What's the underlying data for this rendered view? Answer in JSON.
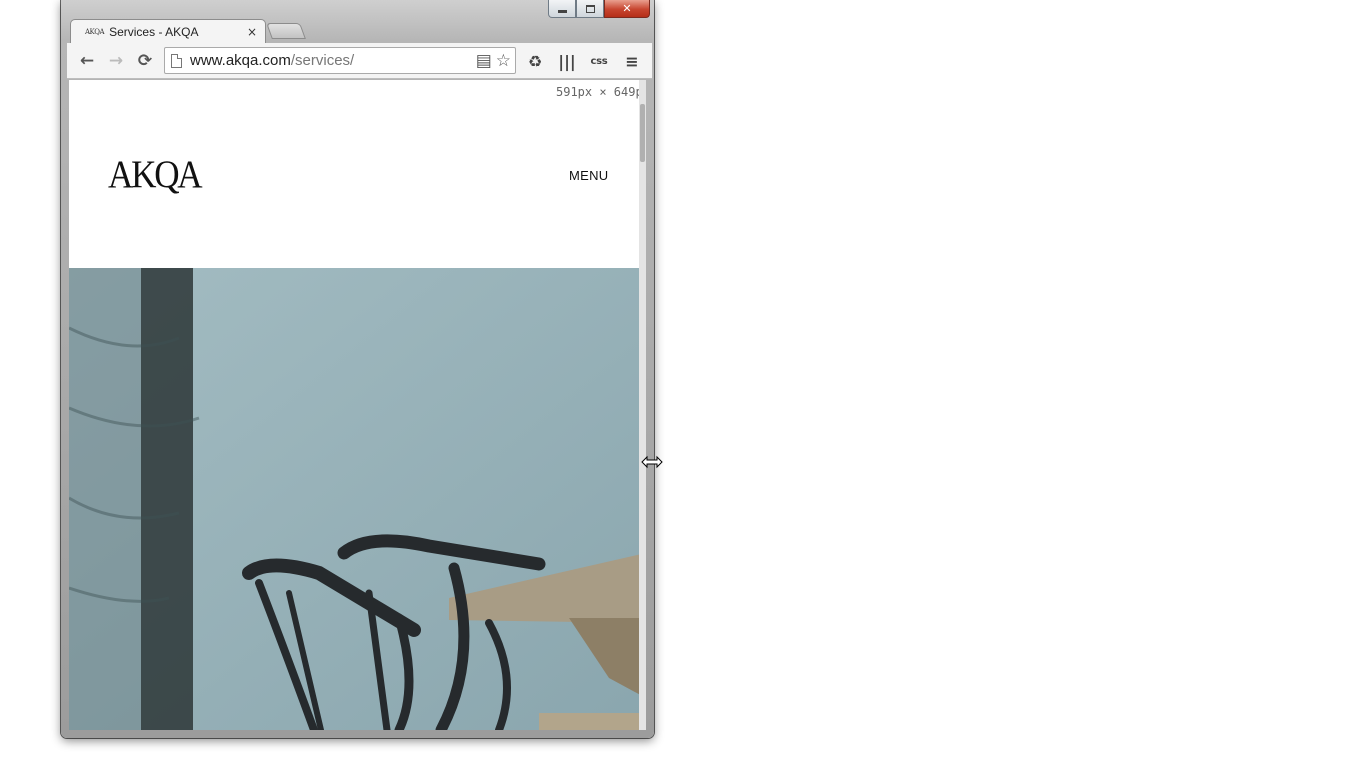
{
  "browser": {
    "tab": {
      "favicon_text": "AKQA",
      "title": "Services - AKQA",
      "close_glyph": "×"
    },
    "window_controls": {
      "close_glyph": "✕"
    },
    "toolbar": {
      "back_icon": "back-arrow-icon",
      "forward_icon": "forward-arrow-icon",
      "reload_icon": "reload-icon",
      "back_glyph": "←",
      "forward_glyph": "→",
      "reload_glyph": "⟳",
      "url_host": "www.akqa.com",
      "url_path": "/services/",
      "reader_glyph": "▤",
      "star_glyph": "☆",
      "recycle_glyph": "♻",
      "columns_glyph": "|||",
      "css_label": "css",
      "menu_glyph": "≡"
    }
  },
  "page": {
    "viewport_size_label": "591px × 649p",
    "logo_text": "AKQA",
    "menu_label": "MENU"
  },
  "colors": {
    "hero_sky": "#8aa6ae",
    "hero_wall": "#a3bcc2",
    "hero_pillar": "#303a3b",
    "chair": "#262a2d",
    "table": "#a89c85"
  }
}
